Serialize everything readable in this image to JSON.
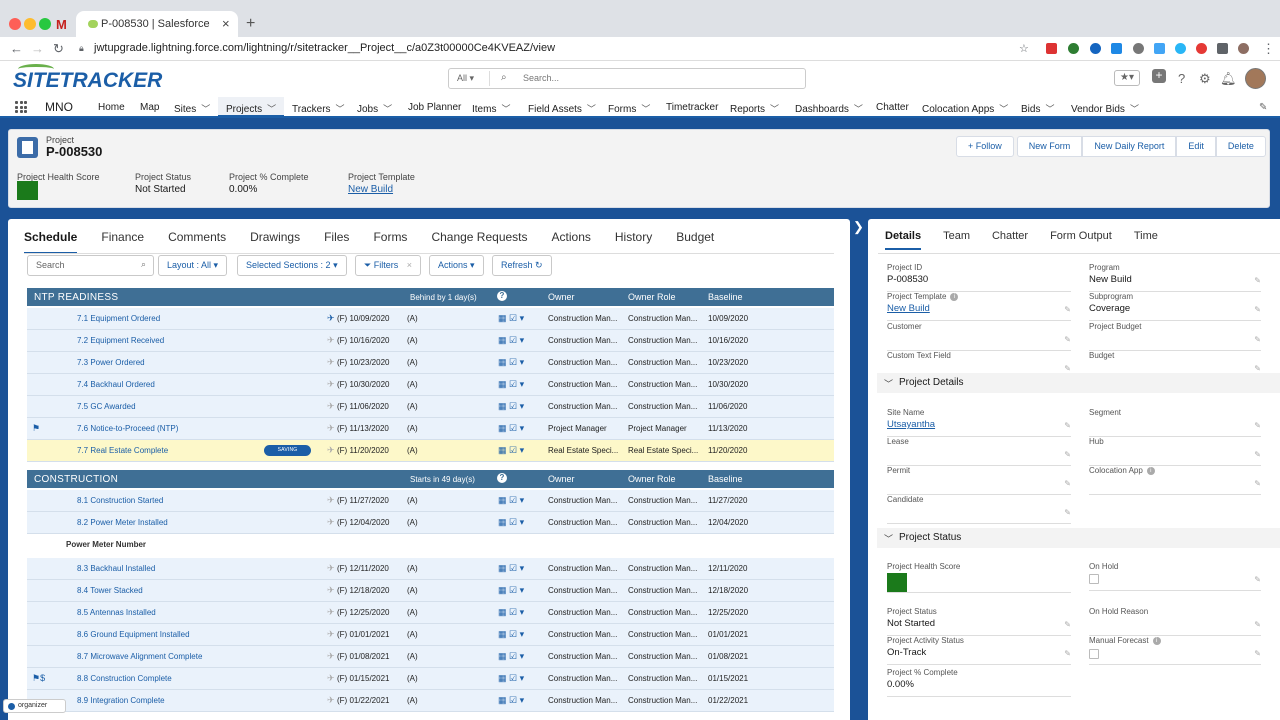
{
  "browser": {
    "tab_title": "P-008530 | Salesforce",
    "gmail_label": "M",
    "url": "jwtupgrade.lightning.force.com/lightning/r/sitetracker__Project__c/a0Z3t00000Ce4KVEAZ/view"
  },
  "header": {
    "logo": "SITETRACKER",
    "search_scope": "All",
    "search_placeholder": "Search..."
  },
  "appnav": {
    "app_name": "MNO",
    "items": [
      {
        "label": "Home",
        "chevron": false
      },
      {
        "label": "Map",
        "chevron": false
      },
      {
        "label": "Sites",
        "chevron": true
      },
      {
        "label": "Projects",
        "chevron": true
      },
      {
        "label": "Trackers",
        "chevron": true
      },
      {
        "label": "Jobs",
        "chevron": true
      },
      {
        "label": "Job Planner",
        "chevron": false
      },
      {
        "label": "Items",
        "chevron": true
      },
      {
        "label": "Field Assets",
        "chevron": true
      },
      {
        "label": "Forms",
        "chevron": true
      },
      {
        "label": "Timetracker",
        "chevron": false
      },
      {
        "label": "Reports",
        "chevron": true
      },
      {
        "label": "Dashboards",
        "chevron": true
      },
      {
        "label": "Chatter",
        "chevron": false
      },
      {
        "label": "Colocation Apps",
        "chevron": true
      },
      {
        "label": "Bids",
        "chevron": true
      },
      {
        "label": "Vendor Bids",
        "chevron": true
      }
    ]
  },
  "record": {
    "type": "Project",
    "name": "P-008530",
    "buttons": {
      "follow": "Follow",
      "new_form": "New Form",
      "new_daily_report": "New Daily Report",
      "edit": "Edit",
      "delete": "Delete"
    },
    "fields": {
      "health_label": "Project Health Score",
      "status_label": "Project Status",
      "status_value": "Not Started",
      "complete_label": "Project % Complete",
      "complete_value": "0.00%",
      "template_label": "Project Template",
      "template_value": "New Build"
    },
    "health_color": "#1b7a1b"
  },
  "main": {
    "tabs": [
      "Schedule",
      "Finance",
      "Comments",
      "Drawings",
      "Files",
      "Forms",
      "Change Requests",
      "Actions",
      "History",
      "Budget"
    ],
    "toolbar": {
      "search_placeholder": "Search",
      "layout": "Layout : All",
      "sections": "Selected Sections : 2",
      "filters": "Filters",
      "actions": "Actions",
      "refresh": "Refresh"
    },
    "columns": {
      "owner": "Owner",
      "owner_role": "Owner Role",
      "baseline": "Baseline"
    },
    "saving_label": "SAVING",
    "sections": [
      {
        "title": "NTP READINESS",
        "status": "Behind by 1 day(s)",
        "rows": [
          {
            "name": "7.1 Equipment Ordered",
            "pinned": true,
            "flag": "",
            "date": "(F)  10/09/2020",
            "a": "(A)",
            "owner": "Construction Man...",
            "role": "Construction Man...",
            "baseline": "10/09/2020"
          },
          {
            "name": "7.2 Equipment Received",
            "pinned": false,
            "flag": "",
            "date": "(F)  10/16/2020",
            "a": "(A)",
            "owner": "Construction Man...",
            "role": "Construction Man...",
            "baseline": "10/16/2020"
          },
          {
            "name": "7.3 Power Ordered",
            "pinned": false,
            "flag": "",
            "date": "(F)  10/23/2020",
            "a": "(A)",
            "owner": "Construction Man...",
            "role": "Construction Man...",
            "baseline": "10/23/2020"
          },
          {
            "name": "7.4 Backhaul Ordered",
            "pinned": false,
            "flag": "",
            "date": "(F)  10/30/2020",
            "a": "(A)",
            "owner": "Construction Man...",
            "role": "Construction Man...",
            "baseline": "10/30/2020"
          },
          {
            "name": "7.5 GC Awarded",
            "pinned": false,
            "flag": "",
            "date": "(F)  11/06/2020",
            "a": "(A)",
            "owner": "Construction Man...",
            "role": "Construction Man...",
            "baseline": "11/06/2020"
          },
          {
            "name": "7.6 Notice-to-Proceed (NTP)",
            "pinned": false,
            "flag": "⚑",
            "date": "(F)  11/13/2020",
            "a": "(A)",
            "owner": "Project Manager",
            "role": "Project Manager",
            "baseline": "11/13/2020"
          },
          {
            "name": "7.7 Real Estate Complete",
            "pinned": false,
            "flag": "",
            "date": "(F)  11/20/2020",
            "a": "(A)",
            "owner": "Real Estate Speci...",
            "role": "Real Estate Speci...",
            "baseline": "11/20/2020",
            "selected": true,
            "saving": true
          }
        ]
      },
      {
        "title": "CONSTRUCTION",
        "status": "Starts in 49 day(s)",
        "rows": [
          {
            "name": "8.1 Construction Started",
            "pinned": false,
            "flag": "",
            "date": "(F)  11/27/2020",
            "a": "(A)",
            "owner": "Construction Man...",
            "role": "Construction Man...",
            "baseline": "11/27/2020"
          },
          {
            "name": "8.2 Power Meter Installed",
            "pinned": false,
            "flag": "",
            "date": "(F)  12/04/2020",
            "a": "(A)",
            "owner": "Construction Man...",
            "role": "Construction Man...",
            "baseline": "12/04/2020"
          },
          {
            "subheading": "Power Meter Number"
          },
          {
            "name": "8.3 Backhaul Installed",
            "pinned": false,
            "flag": "",
            "date": "(F)  12/11/2020",
            "a": "(A)",
            "owner": "Construction Man...",
            "role": "Construction Man...",
            "baseline": "12/11/2020"
          },
          {
            "name": "8.4 Tower Stacked",
            "pinned": false,
            "flag": "",
            "date": "(F)  12/18/2020",
            "a": "(A)",
            "owner": "Construction Man...",
            "role": "Construction Man...",
            "baseline": "12/18/2020"
          },
          {
            "name": "8.5 Antennas Installed",
            "pinned": false,
            "flag": "",
            "date": "(F)  12/25/2020",
            "a": "(A)",
            "owner": "Construction Man...",
            "role": "Construction Man...",
            "baseline": "12/25/2020"
          },
          {
            "name": "8.6 Ground Equipment Installed",
            "pinned": false,
            "flag": "",
            "date": "(F)  01/01/2021",
            "a": "(A)",
            "owner": "Construction Man...",
            "role": "Construction Man...",
            "baseline": "01/01/2021"
          },
          {
            "name": "8.7 Microwave Alignment Complete",
            "pinned": false,
            "flag": "",
            "date": "(F)  01/08/2021",
            "a": "(A)",
            "owner": "Construction Man...",
            "role": "Construction Man...",
            "baseline": "01/08/2021"
          },
          {
            "name": "8.8 Construction Complete",
            "pinned": false,
            "flag": "⚑$",
            "date": "(F)  01/15/2021",
            "a": "(A)",
            "owner": "Construction Man...",
            "role": "Construction Man...",
            "baseline": "01/15/2021"
          },
          {
            "name": "8.9 Integration Complete",
            "pinned": false,
            "flag": "",
            "date": "(F)  01/22/2021",
            "a": "(A)",
            "owner": "Construction Man...",
            "role": "Construction Man...",
            "baseline": "01/22/2021"
          }
        ]
      }
    ]
  },
  "detail": {
    "tabs": [
      "Details",
      "Team",
      "Chatter",
      "Form Output",
      "Time"
    ],
    "top_fields": [
      {
        "label": "Project ID",
        "value": "P-008530",
        "link": false,
        "editable": false,
        "info": false
      },
      {
        "label": "Program",
        "value": "New Build",
        "link": false,
        "editable": true,
        "info": false
      },
      {
        "label": "Project Template",
        "value": "New Build",
        "link": true,
        "editable": true,
        "info": true
      },
      {
        "label": "Subprogram",
        "value": "Coverage",
        "link": false,
        "editable": true,
        "info": false
      },
      {
        "label": "Customer",
        "value": "",
        "link": false,
        "editable": true,
        "info": false
      },
      {
        "label": "Project Budget",
        "value": "",
        "link": false,
        "editable": true,
        "info": false
      },
      {
        "label": "Custom Text Field",
        "value": "",
        "link": false,
        "editable": true,
        "info": false
      },
      {
        "label": "Budget",
        "value": "",
        "link": false,
        "editable": true,
        "info": false
      }
    ],
    "project_details_title": "Project Details",
    "project_details_fields": [
      {
        "label": "Site Name",
        "value": "Utsayantha",
        "link": true,
        "editable": true,
        "info": false
      },
      {
        "label": "Segment",
        "value": "",
        "link": false,
        "editable": true,
        "info": false
      },
      {
        "label": "Lease",
        "value": "",
        "link": false,
        "editable": true,
        "info": false
      },
      {
        "label": "Hub",
        "value": "",
        "link": false,
        "editable": true,
        "info": false
      },
      {
        "label": "Permit",
        "value": "",
        "link": false,
        "editable": true,
        "info": false
      },
      {
        "label": "Colocation App",
        "value": "",
        "link": false,
        "editable": true,
        "info": true
      },
      {
        "label": "Candidate",
        "value": "",
        "link": false,
        "editable": true,
        "info": false
      }
    ],
    "project_status_title": "Project Status",
    "project_status_fields": {
      "health_label": "Project Health Score",
      "on_hold_label": "On Hold",
      "status_label": "Project Status",
      "status_value": "Not Started",
      "on_hold_reason_label": "On Hold Reason",
      "activity_label": "Project Activity Status",
      "activity_value": "On-Track",
      "manual_forecast_label": "Manual Forecast",
      "complete_label": "Project % Complete",
      "complete_value": "0.00%"
    }
  },
  "organizer_label": "organizer"
}
